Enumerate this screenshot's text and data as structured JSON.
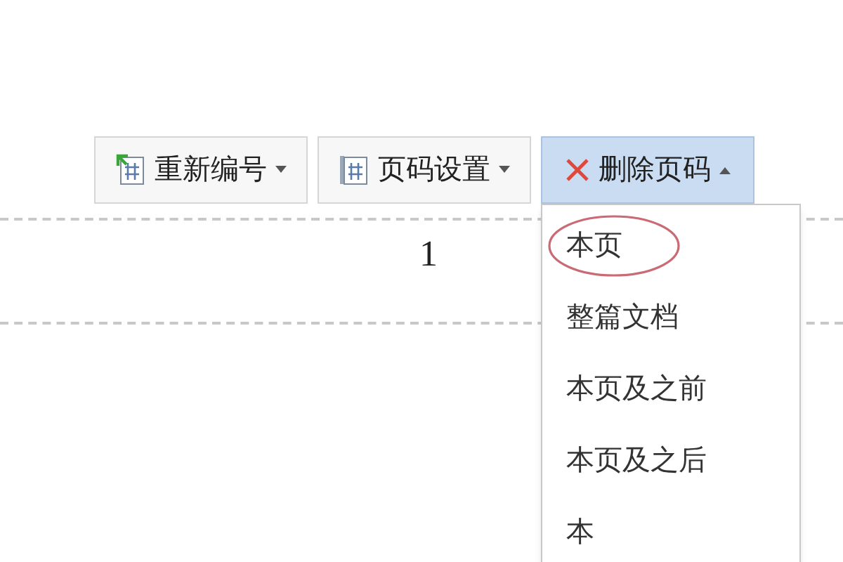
{
  "toolbar": {
    "buttons": [
      {
        "kind": "renumber",
        "label": "重新编号",
        "selected": false
      },
      {
        "kind": "settings",
        "label": "页码设置",
        "selected": false
      },
      {
        "kind": "delete",
        "label": "删除页码",
        "selected": true
      }
    ]
  },
  "page": {
    "page_number": "1"
  },
  "menu": {
    "items": [
      {
        "label": "本页",
        "circled": true
      },
      {
        "label": "整篇文档",
        "circled": false
      },
      {
        "label": "本页及之前",
        "circled": false
      },
      {
        "label": "本页及之后",
        "circled": false
      },
      {
        "label": "本",
        "circled": false
      }
    ]
  }
}
